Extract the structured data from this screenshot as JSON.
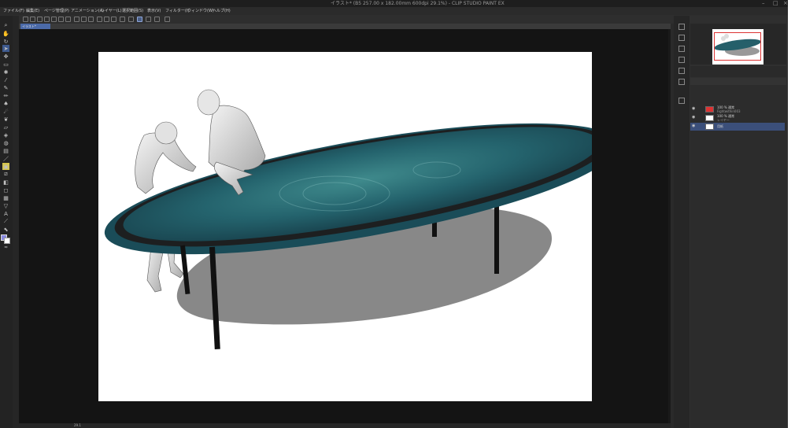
{
  "window": {
    "title": "イラスト* (B5 257.00 x 182.00mm 600dpi 29.1%) - CLIP STUDIO PAINT EX"
  },
  "menubar": {
    "items": [
      {
        "label": "ファイル(F)"
      },
      {
        "label": "編集(E)"
      },
      {
        "label": "ページ管理(P)"
      },
      {
        "label": "アニメーション(A)"
      },
      {
        "label": "レイヤー(L)"
      },
      {
        "label": "選択範囲(S)"
      },
      {
        "label": "表示(V)"
      },
      {
        "label": "フィルター(I)"
      },
      {
        "label": "ウィンドウ(W)"
      },
      {
        "label": "ヘルプ(H)"
      }
    ]
  },
  "document_tab": {
    "label": "イラスト*"
  },
  "layers": {
    "rows": [
      {
        "name": "100 % 通常",
        "sub": "Fightwithin003"
      },
      {
        "name": "100 % 通常",
        "sub": "レイヤー"
      },
      {
        "name": "用紙",
        "sub": ""
      }
    ]
  },
  "status": {
    "zoom": "29.1"
  },
  "colors": {
    "accent": "#4b6aa8",
    "selected_layer": "#3b4f7a",
    "main_color": "#8a8ae0",
    "table_surface": "#1f5a64"
  }
}
